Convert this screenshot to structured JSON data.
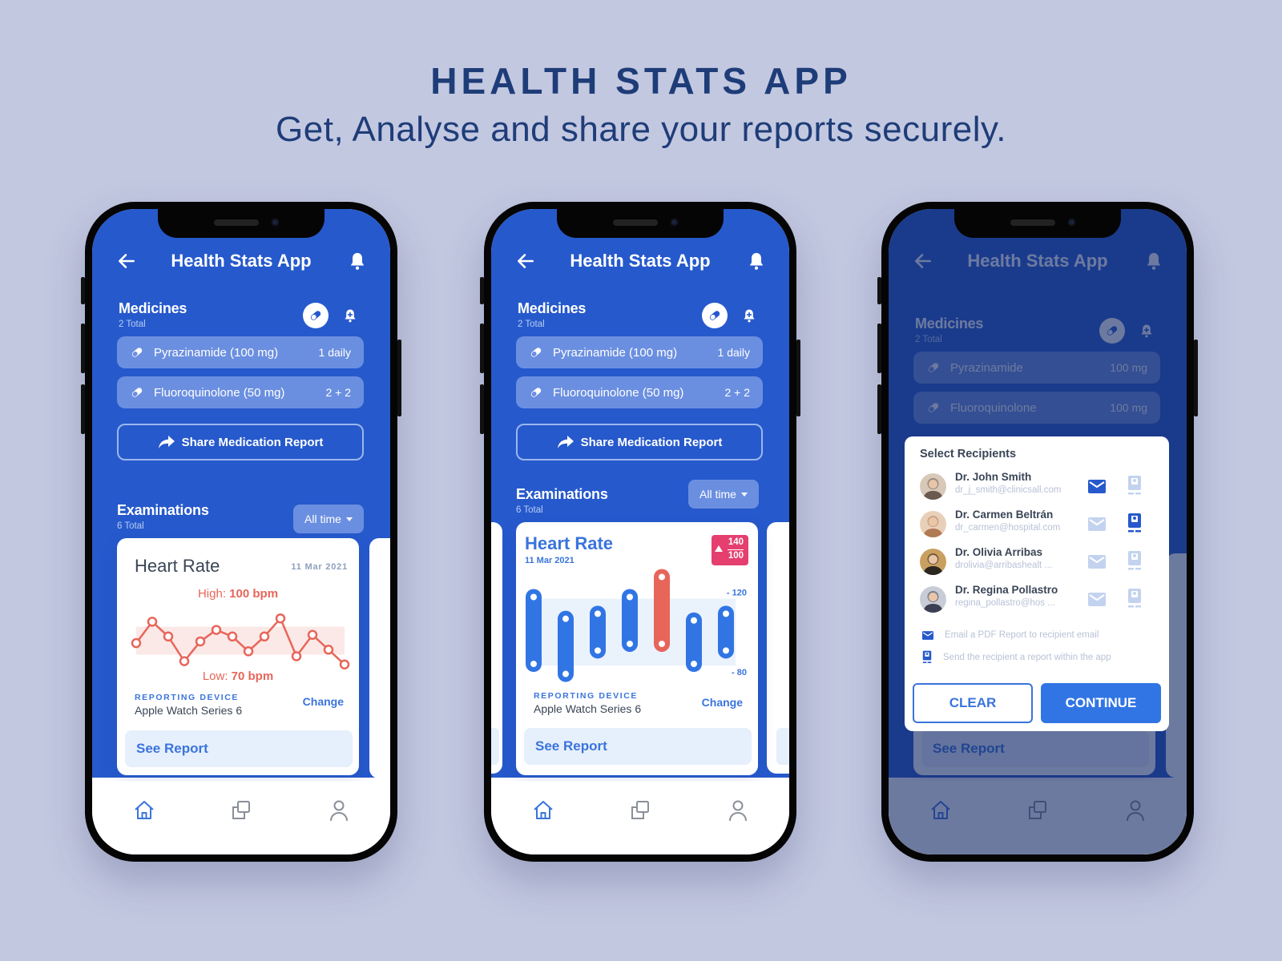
{
  "hero": {
    "title": "HEALTH STATS APP",
    "subtitle": "Get, Analyse and share your reports securely."
  },
  "colors": {
    "background": "#c3c8e1",
    "primary_blue": "#2659cc",
    "accent_blue": "#3a74dc",
    "alert_red": "#e8655a",
    "alert_badge": "#e53f6f",
    "heading_navy": "#1e3d78"
  },
  "app": {
    "title": "Health Stats App",
    "back_icon": "arrow-left-icon",
    "notification_icon": "bell-icon"
  },
  "medicines": {
    "title": "Medicines",
    "count": "2 Total",
    "items": [
      {
        "name": "Pyrazinamide (100 mg)",
        "dose": "1 daily",
        "icon": "pill-icon"
      },
      {
        "name": "Fluoroquinolone (50 mg)",
        "dose": "2 + 2",
        "icon": "pill-icon"
      }
    ],
    "share_label": "Share Medication Report"
  },
  "examinations": {
    "title": "Examinations",
    "count": "6 Total",
    "filter": "All time"
  },
  "screen1_card": {
    "title": "Heart Rate",
    "date": "11 Mar 2021",
    "high_label": "High:",
    "high_value": "100 bpm",
    "low_label": "Low:",
    "low_value": "70 bpm",
    "reporting_label": "REPORTING DEVICE",
    "device": "Apple Watch Series 6",
    "change_label": "Change",
    "see_report": "See Report"
  },
  "screen2_card": {
    "title": "Heart Rate",
    "date": "11 Mar 2021",
    "badge_top": "140",
    "badge_bottom": "100",
    "axis_top": "- 120",
    "axis_bottom": "- 80",
    "reporting_label": "REPORTING DEVICE",
    "device": "Apple Watch Series 6",
    "change_label": "Change",
    "see_report": "See Report"
  },
  "screen3": {
    "medicines": [
      {
        "name": "Pyrazinamide",
        "dose": "100 mg"
      },
      {
        "name": "Fluoroquinolone",
        "dose": "100 mg"
      }
    ],
    "modal": {
      "title": "Select Recipients",
      "recipients": [
        {
          "name": "Dr. John Smith",
          "email": "dr_j_smith@clinicsall.com",
          "email_selected": true,
          "inapp_selected": false
        },
        {
          "name": "Dr. Carmen Beltrán",
          "email": "dr_carmen@hospital.com",
          "email_selected": false,
          "inapp_selected": true
        },
        {
          "name": "Dr. Olivia Arribas",
          "email": "drolivia@arribashealt ...",
          "email_selected": false,
          "inapp_selected": false
        },
        {
          "name": "Dr. Regina Pollastro",
          "email": "regina_pollastro@hos ...",
          "email_selected": false,
          "inapp_selected": false
        }
      ],
      "legend_email": "Email a PDF Report to recipient email",
      "legend_inapp": "Send the recipient a report within the app",
      "clear_label": "CLEAR",
      "continue_label": "CONTINUE"
    },
    "see_report": "See Report"
  },
  "tabbar": {
    "items": [
      {
        "icon": "home-icon",
        "active": true
      },
      {
        "icon": "windows-icon",
        "active": false
      },
      {
        "icon": "profile-icon",
        "active": false
      }
    ]
  },
  "chart_data": [
    {
      "type": "line",
      "title": "Heart Rate",
      "ylabel": "bpm",
      "x": [
        1,
        2,
        3,
        4,
        5,
        6,
        7,
        8,
        9,
        10,
        11,
        12,
        13,
        14
      ],
      "values": [
        83,
        96,
        87,
        72,
        84,
        91,
        87,
        78,
        87,
        98,
        75,
        88,
        79,
        70
      ],
      "normal_band": [
        76,
        93
      ],
      "ylim": [
        65,
        102
      ],
      "annotations": [
        "High: 100 bpm",
        "Low: 70 bpm"
      ]
    },
    {
      "type": "bar",
      "subtype": "range",
      "title": "Heart Rate",
      "categories": [
        "1",
        "2",
        "3",
        "4",
        "5",
        "6",
        "7"
      ],
      "series": [
        {
          "name": "high",
          "values": [
            121,
            108,
            111,
            121,
            133,
            107,
            111
          ]
        },
        {
          "name": "low",
          "values": [
            81,
            75,
            89,
            93,
            93,
            81,
            89
          ]
        }
      ],
      "highlight_index": 4,
      "reference_band": [
        80,
        120
      ],
      "ytick_labels": [
        "120",
        "80"
      ],
      "ylim": [
        70,
        138
      ]
    }
  ]
}
